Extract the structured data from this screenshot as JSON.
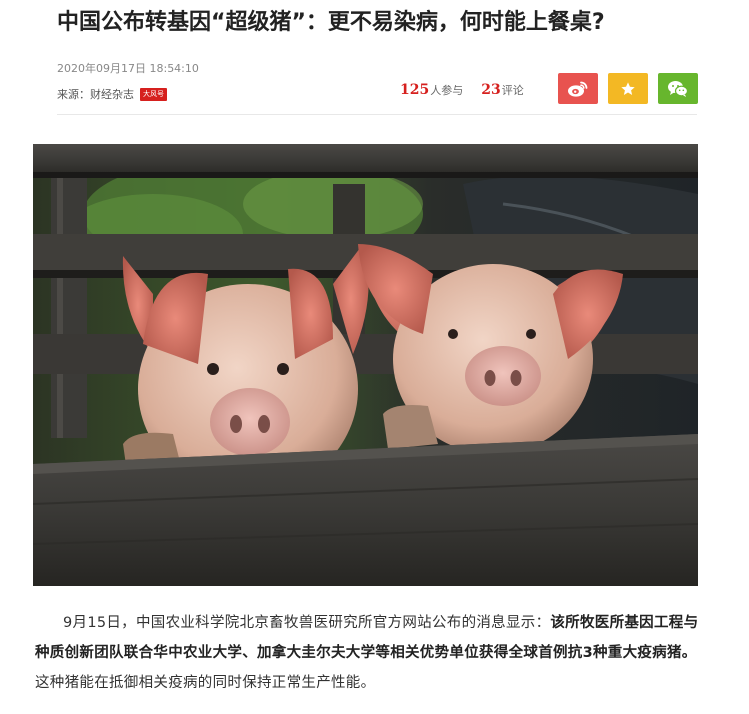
{
  "article": {
    "title": "中国公布转基因“超级猪”：更不易染病，何时能上餐桌?",
    "date": "2020年09月17日 18:54:10",
    "source_label": "来源：财经杂志",
    "source_badge": "大风号",
    "participants_count": "125",
    "participants_label": "人参与",
    "comments_count": "23",
    "comments_label": "评论"
  },
  "share": {
    "weibo_icon": "weibo-icon",
    "favorite_icon": "star-icon",
    "wechat_icon": "wechat-icon",
    "colors": {
      "weibo": "#e8534f",
      "favorite": "#f3b824",
      "wechat": "#67b62d"
    }
  },
  "image": {
    "subject": "two-pigs-looking-over-wooden-fence"
  },
  "paragraph": {
    "lead": "9月15日，中国农业科学院北京畜牧兽医研究所官方网站公布的消息显示：",
    "bold": "该所牧医所基因工程与种质创新团队联合华中农业大学、加拿大圭尔夫大学等相关优势单位获得全球首例抗3种重大疫病猪。",
    "tail": "这种猪能在抵御相关疫病的同时保持正常生产性能。"
  },
  "colors": {
    "accent": "#d6201e"
  }
}
